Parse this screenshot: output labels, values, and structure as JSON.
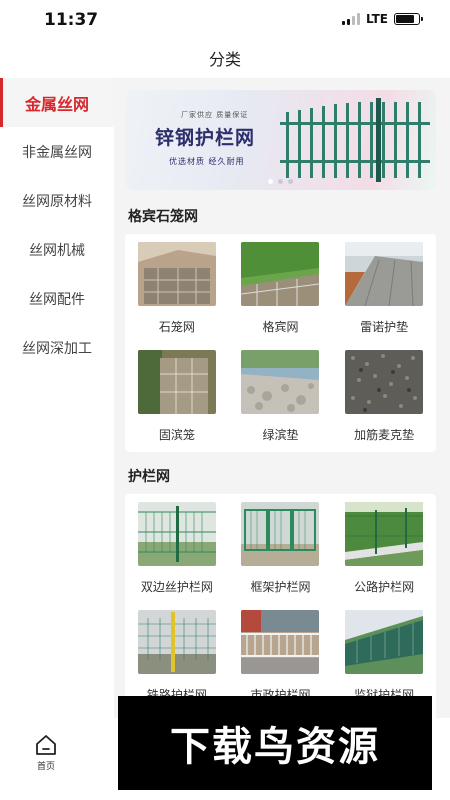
{
  "status_bar": {
    "time": "11:37",
    "network": "LTE",
    "battery_level": 0.8
  },
  "header": {
    "title": "分类"
  },
  "sidebar": {
    "items": [
      {
        "label": "金属丝网",
        "active": true
      },
      {
        "label": "非金属丝网",
        "active": false
      },
      {
        "label": "丝网原材料",
        "active": false
      },
      {
        "label": "丝网机械",
        "active": false
      },
      {
        "label": "丝网配件",
        "active": false
      },
      {
        "label": "丝网深加工",
        "active": false
      }
    ]
  },
  "banner": {
    "small_text": "厂家供应  质量保证",
    "title": "锌钢护栏网",
    "subtitle": "优选材质  经久耐用",
    "slide_count": 3,
    "active_slide": 1
  },
  "sections": [
    {
      "title": "格宾石笼网",
      "items": [
        {
          "label": "石笼网",
          "icon": "gabion-photo"
        },
        {
          "label": "格宾网",
          "icon": "gabion-slope-photo"
        },
        {
          "label": "雷诺护垫",
          "icon": "reno-mattress-photo"
        },
        {
          "label": "固滨笼",
          "icon": "gabion-wall-photo"
        },
        {
          "label": "绿滨垫",
          "icon": "green-mattress-photo"
        },
        {
          "label": "加筋麦克垫",
          "icon": "macmat-photo"
        }
      ]
    },
    {
      "title": "护栏网",
      "items": [
        {
          "label": "双边丝护栏网",
          "icon": "double-wire-fence-photo"
        },
        {
          "label": "框架护栏网",
          "icon": "frame-fence-photo"
        },
        {
          "label": "公路护栏网",
          "icon": "highway-fence-photo"
        },
        {
          "label": "铁路护栏网",
          "icon": "railway-fence-photo"
        },
        {
          "label": "市政护栏网",
          "icon": "municipal-fence-photo"
        },
        {
          "label": "监狱护栏网",
          "icon": "prison-fence-photo"
        }
      ]
    }
  ],
  "tabbar": {
    "home_label": "首页"
  },
  "watermark": {
    "text": "下载鸟资源"
  },
  "colors": {
    "accent": "#d7282e",
    "content_bg": "#f4f4f4",
    "banner_title": "#2c2f6b"
  }
}
